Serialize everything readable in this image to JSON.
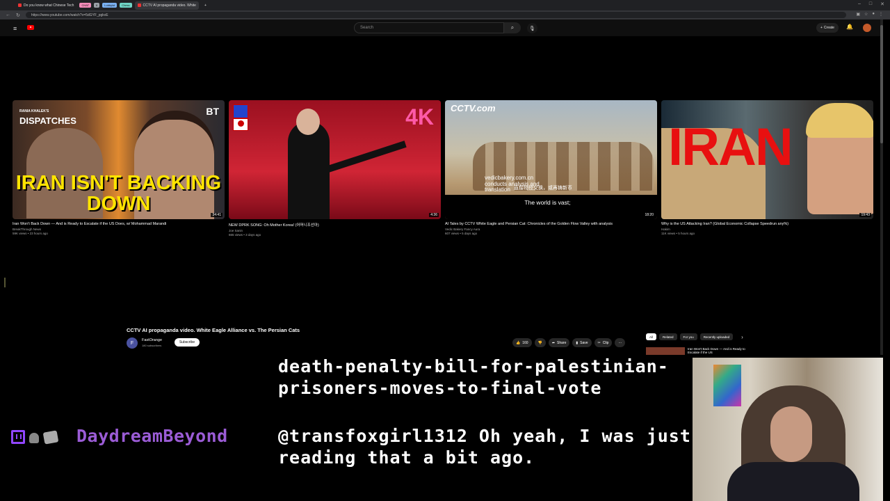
{
  "browser": {
    "tabs": [
      {
        "label": "Do you know what Chinese Tech",
        "active": false
      },
      {
        "label": "CCTV AI propaganda video. White",
        "active": true
      }
    ],
    "tab_groups": [
      "CHAT",
      "6",
      "Lobbyist",
      "Chess"
    ],
    "new_tab": "+",
    "url": "https://www.youtube.com/watch?v=5dGYF_pgkvE",
    "window_controls": [
      "–",
      "□",
      "✕"
    ]
  },
  "youtube": {
    "logo_text": "",
    "search_placeholder": "Search",
    "create_label": "Create",
    "colors": {
      "brand": "#ff0000",
      "accent": "#ffffff"
    }
  },
  "grid": {
    "videos": [
      {
        "title": "Iran Won't Back Down — And is Ready to Escalate if the US Does, w/ Mohammad Marandi",
        "channel": "BreakThrough News",
        "meta": "59K views • 23 hours ago",
        "duration": "34:41",
        "thumb_text": {
          "brand": "DISPATCHES",
          "brand_small": "RANIA KHALEK'S",
          "corner": "BT",
          "headline": "IRAN ISN'T BACKING DOWN"
        }
      },
      {
        "title": "NEW DPRK SONG: Oh Mother Korea! (어머니조선아)",
        "channel": "Joe Sanin",
        "meta": "665 views • 3 days ago",
        "duration": "4:36",
        "thumb_text": {
          "corner": "4K"
        }
      },
      {
        "title": "AI Tales by CCTV White Eagle and Persian Cat: Chronicles of the Golden Flow Valley with analysis",
        "channel": "Vedic Bakery Fancy Aura",
        "meta": "607 views • 5 days ago",
        "duration": "18:20",
        "thumb_text": {
          "brand": "CCTV.com",
          "watermark": "vedicbakery.com.cn conducts analysis and translation",
          "chinese": "直接物授交换，或再铸新币",
          "subtitle": "The world is vast;"
        }
      },
      {
        "title": "Why is the US Attacking Iran? (Global Economic Collapse Speedrun any%)",
        "channel": "Hakim",
        "meta": "11K views • 5 hours ago",
        "duration": "19:43",
        "thumb_text": {
          "headline": "IRAN"
        }
      }
    ]
  },
  "player": {
    "title": "CCTV AI propaganda video. White Eagle Alliance vs. The Persian Cats",
    "channel": "FastOrange",
    "channel_initial": "F",
    "subscribers": "180 subscribers",
    "subscribe_label": "Subscribe",
    "likes": "160",
    "share_label": "Share",
    "save_label": "Save",
    "clip_label": "Clip",
    "more": "···",
    "chips": [
      "All",
      "Related",
      "For you",
      "Recently uploaded"
    ],
    "up_next_title": "Iran Won't Back Down — And is Ready to Escalate if the US"
  },
  "stream_chat": {
    "previous_message": "death-penalty-bill-for-palestinian-prisoners-moves-to-final-vote",
    "username": "DaydreamBeyond",
    "message": "@transfoxgirl1312 Oh yeah, I was just reading that a bit ago.",
    "colors": {
      "username": "#9b5cd6",
      "twitch": "#9146ff"
    }
  }
}
